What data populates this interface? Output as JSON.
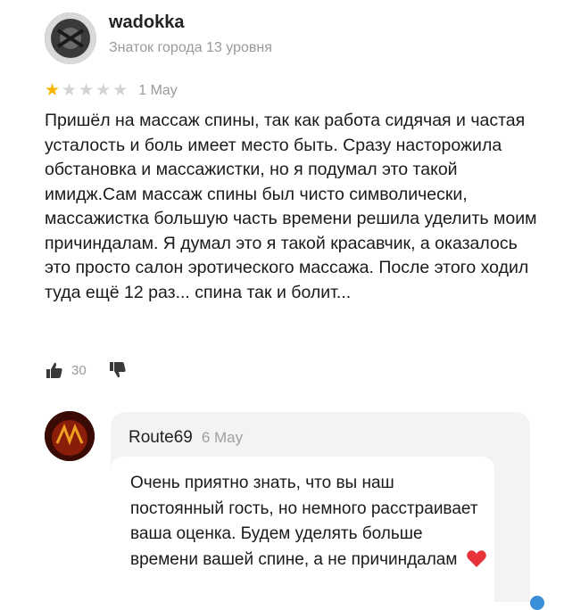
{
  "review": {
    "author": "wadokka",
    "status": "Знаток города 13 уровня",
    "rating": 1,
    "rating_max": 5,
    "date": "1 May",
    "text": "Пришёл на массаж спины, так как работа сидячая и частая усталость и боль имеет место быть. Сразу насторожила обстановка и массажистки, но я подумал это такой имидж.Сам массаж спины был чисто символически, массажистка большую часть времени решила уделить моим причиндалам. Я думал это я такой красавчик, а оказалось это просто салон эротического массажа. После этого ходил туда ещё 12 раз... спина так и болит...",
    "likes": "30",
    "icons": {
      "like": "thumbs-up-icon",
      "dislike": "thumbs-down-icon"
    }
  },
  "reply": {
    "author": "Route69",
    "date": "6 May",
    "text": "Очень приятно знать, что вы наш постоянный гость, но немного расстраивает ваша оценка. Будем уделять больше времени вашей спине, а не причиндалам",
    "emoji": "heart-icon"
  },
  "colors": {
    "star_filled": "#f5b400",
    "star_empty": "#d3d3d3",
    "muted_text": "#9a9a9a",
    "reply_bg": "#f3f3f3",
    "heart": "#e8333a"
  }
}
